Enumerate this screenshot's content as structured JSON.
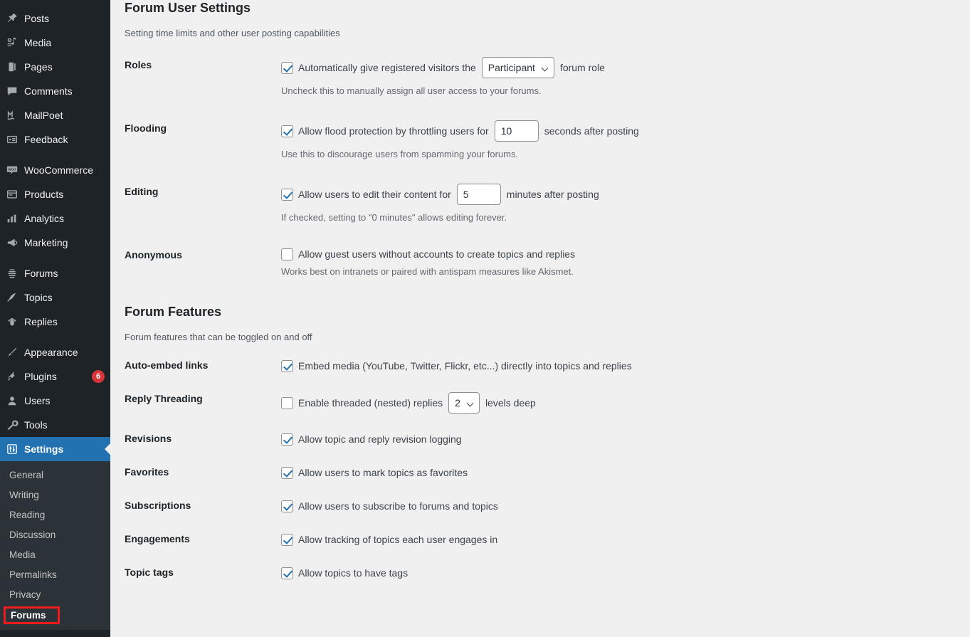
{
  "sidebar": {
    "groups": [
      {
        "items": [
          {
            "label": "Posts",
            "icon": "pin-icon",
            "name": "posts"
          },
          {
            "label": "Media",
            "icon": "media-icon",
            "name": "media"
          },
          {
            "label": "Pages",
            "icon": "pages-icon",
            "name": "pages"
          },
          {
            "label": "Comments",
            "icon": "comments-icon",
            "name": "comments"
          },
          {
            "label": "MailPoet",
            "icon": "mailpoet-icon",
            "name": "mailpoet"
          },
          {
            "label": "Feedback",
            "icon": "feedback-icon",
            "name": "feedback"
          }
        ]
      },
      {
        "items": [
          {
            "label": "WooCommerce",
            "icon": "woocommerce-icon",
            "name": "woocommerce"
          },
          {
            "label": "Products",
            "icon": "products-icon",
            "name": "products"
          },
          {
            "label": "Analytics",
            "icon": "analytics-icon",
            "name": "analytics"
          },
          {
            "label": "Marketing",
            "icon": "marketing-icon",
            "name": "marketing"
          }
        ]
      },
      {
        "items": [
          {
            "label": "Forums",
            "icon": "beehive-icon",
            "name": "forums"
          },
          {
            "label": "Topics",
            "icon": "quill-icon",
            "name": "topics"
          },
          {
            "label": "Replies",
            "icon": "bee-icon",
            "name": "replies"
          }
        ]
      },
      {
        "items": [
          {
            "label": "Appearance",
            "icon": "paintbrush-icon",
            "name": "appearance"
          },
          {
            "label": "Plugins",
            "icon": "plug-icon",
            "name": "plugins",
            "badge": "6"
          },
          {
            "label": "Users",
            "icon": "user-icon",
            "name": "users"
          },
          {
            "label": "Tools",
            "icon": "wrench-icon",
            "name": "tools"
          },
          {
            "label": "Settings",
            "icon": "sliders-icon",
            "name": "settings",
            "current": true
          }
        ]
      }
    ],
    "submenu": {
      "items": [
        {
          "label": "General",
          "name": "general"
        },
        {
          "label": "Writing",
          "name": "writing"
        },
        {
          "label": "Reading",
          "name": "reading"
        },
        {
          "label": "Discussion",
          "name": "discussion"
        },
        {
          "label": "Media",
          "name": "media"
        },
        {
          "label": "Permalinks",
          "name": "permalinks"
        },
        {
          "label": "Privacy",
          "name": "privacy"
        }
      ],
      "highlighted": {
        "label": "Forums",
        "name": "forums"
      }
    }
  },
  "main": {
    "user_settings": {
      "title": "Forum User Settings",
      "description": "Setting time limits and other user posting capabilities",
      "roles": {
        "label": "Roles",
        "text_before": "Automatically give registered visitors the",
        "select_value": "Participant",
        "text_after": "forum role",
        "helper": "Uncheck this to manually assign all user access to your forums.",
        "checked": true
      },
      "flooding": {
        "label": "Flooding",
        "text_before": "Allow flood protection by throttling users for",
        "input_value": "10",
        "text_after": "seconds after posting",
        "helper": "Use this to discourage users from spamming your forums.",
        "checked": true
      },
      "editing": {
        "label": "Editing",
        "text_before": "Allow users to edit their content for",
        "input_value": "5",
        "text_after": "minutes after posting",
        "helper": "If checked, setting to \"0 minutes\" allows editing forever.",
        "checked": true
      },
      "anonymous": {
        "label": "Anonymous",
        "text": "Allow guest users without accounts to create topics and replies",
        "helper": "Works best on intranets or paired with antispam measures like Akismet.",
        "checked": false
      }
    },
    "features": {
      "title": "Forum Features",
      "description": "Forum features that can be toggled on and off",
      "autoembed": {
        "label": "Auto-embed links",
        "text": "Embed media (YouTube, Twitter, Flickr, etc...) directly into topics and replies",
        "checked": true
      },
      "threading": {
        "label": "Reply Threading",
        "text_before": "Enable threaded (nested) replies",
        "select_value": "2",
        "text_after": "levels deep",
        "checked": false
      },
      "revisions": {
        "label": "Revisions",
        "text": "Allow topic and reply revision logging",
        "checked": true
      },
      "favorites": {
        "label": "Favorites",
        "text": "Allow users to mark topics as favorites",
        "checked": true
      },
      "subscriptions": {
        "label": "Subscriptions",
        "text": "Allow users to subscribe to forums and topics",
        "checked": true
      },
      "engagements": {
        "label": "Engagements",
        "text": "Allow tracking of topics each user engages in",
        "checked": true
      },
      "topictags": {
        "label": "Topic tags",
        "text": "Allow topics to have tags",
        "checked": true
      }
    }
  },
  "colors": {
    "accent": "#2271b1",
    "sidebar_bg": "#1d2327",
    "submenu_bg": "#2c3338",
    "content_bg": "#f0f0f1",
    "badge": "#d63638",
    "highlight": "#f01c1c"
  }
}
